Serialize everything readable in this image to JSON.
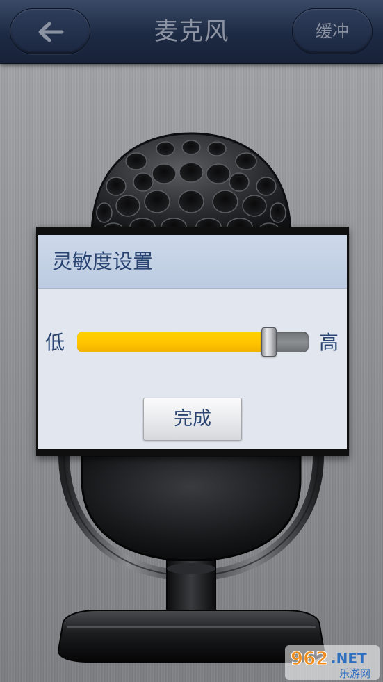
{
  "header": {
    "title": "麦克风",
    "back_icon": "back-arrow-icon",
    "buffer_label": "缓冲"
  },
  "dialog": {
    "title": "灵敏度设置",
    "slider": {
      "low_label": "低",
      "high_label": "高",
      "level": 0.83
    },
    "done_label": "完成"
  },
  "colors": {
    "header_bg": "#1d2a43",
    "dialog_text": "#2a4472",
    "slider_fill": "#ffc400"
  },
  "watermark": {
    "logo_text": "962",
    "domain_suffix": ".NET",
    "caption": "乐游网"
  }
}
